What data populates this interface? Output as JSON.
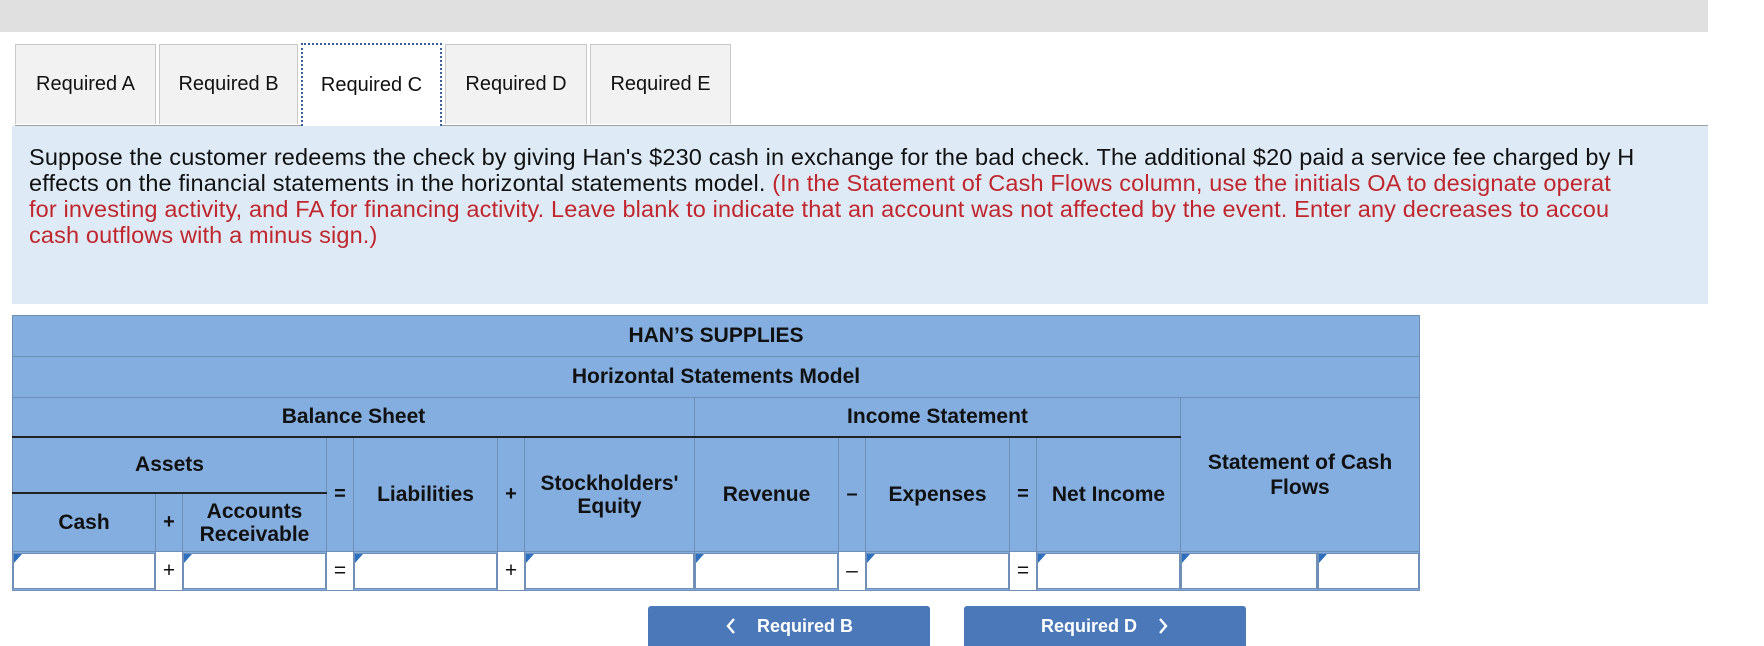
{
  "tabs": [
    {
      "label": "Required A"
    },
    {
      "label": "Required B"
    },
    {
      "label": "Required C"
    },
    {
      "label": "Required D"
    },
    {
      "label": "Required E"
    }
  ],
  "question": {
    "line1": "Suppose the customer redeems the check by giving Han's $230 cash in exchange for the bad check. The additional $20 paid a service fee charged by H",
    "line2_black": "effects on the financial statements in the horizontal statements model. ",
    "line2_red": "(In the Statement of Cash Flows column, use the initials OA to designate operat",
    "line3": "for investing activity, and FA for financing activity. Leave blank to indicate that an account was not affected by the event. Enter any decreases to accou",
    "line4": "cash outflows with a minus sign.)"
  },
  "model": {
    "company": "HAN’S SUPPLIES",
    "subtitle": "Horizontal Statements Model",
    "balance_sheet": "Balance Sheet",
    "income_statement": "Income Statement",
    "assets": "Assets",
    "cash_flows": "Statement of Cash Flows",
    "cash": "Cash",
    "plus1": "+",
    "accounts_receivable": "Accounts Receivable",
    "equals1": "=",
    "liabilities": "Liabilities",
    "plus2": "+",
    "stockholders_equity": "Stockholders' Equity",
    "revenue": "Revenue",
    "minus": "–",
    "expenses": "Expenses",
    "equals2": "=",
    "net_income": "Net Income",
    "input_ops": {
      "plus1": "+",
      "equals1": "=",
      "plus2": "+",
      "minus": "–",
      "equals2": "="
    }
  },
  "nav": {
    "prev_label": "Required B",
    "next_label": "Required D",
    "prev_icon": "chevron-left-icon",
    "next_icon": "chevron-right-icon"
  },
  "colors": {
    "accent_blue": "#4a78b8",
    "table_blue": "#84aee0",
    "question_bg": "#deebf7",
    "instruction_red": "#c0262c"
  }
}
